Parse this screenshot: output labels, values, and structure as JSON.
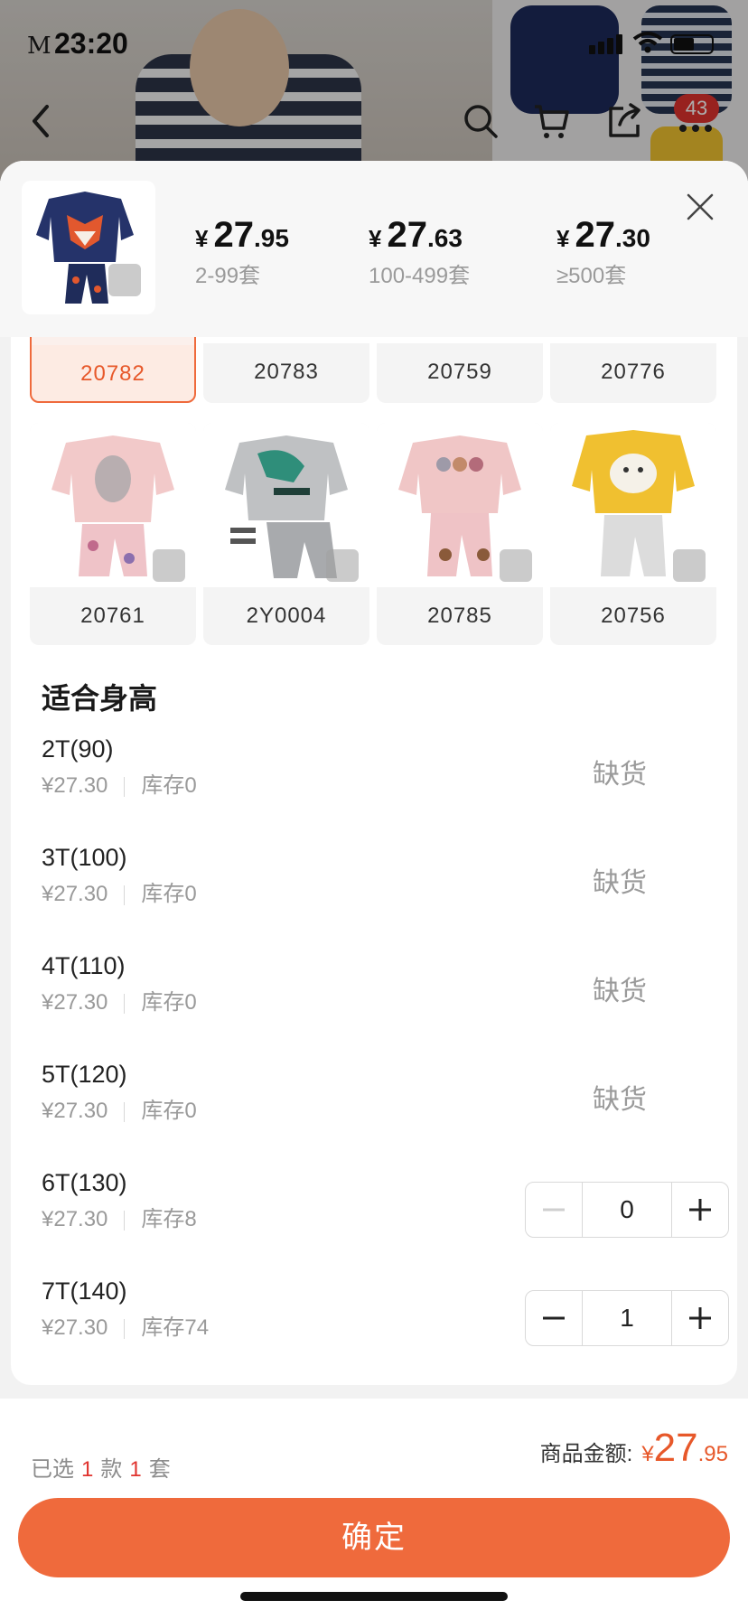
{
  "status_bar": {
    "brand": "M",
    "time": "23:20"
  },
  "nav": {
    "cart_badge": "43"
  },
  "price_tiers": [
    {
      "yen": "¥",
      "int": "27",
      "dec": ".95",
      "qty": "2-99套"
    },
    {
      "yen": "¥",
      "int": "27",
      "dec": ".63",
      "qty": "100-499套"
    },
    {
      "yen": "¥",
      "int": "27",
      "dec": ".30",
      "qty": "≥500套"
    }
  ],
  "swatches_row1": [
    {
      "code": "20782",
      "selected": true
    },
    {
      "code": "20783",
      "selected": false
    },
    {
      "code": "20759",
      "selected": false
    },
    {
      "code": "20776",
      "selected": false
    }
  ],
  "swatches_row2": [
    {
      "code": "20761"
    },
    {
      "code": "2Y0004"
    },
    {
      "code": "20785"
    },
    {
      "code": "20756"
    }
  ],
  "size_section_title": "适合身高",
  "sizes": [
    {
      "name": "2T(90)",
      "price": "¥27.30",
      "stock": "库存0",
      "status": "缺货"
    },
    {
      "name": "3T(100)",
      "price": "¥27.30",
      "stock": "库存0",
      "status": "缺货"
    },
    {
      "name": "4T(110)",
      "price": "¥27.30",
      "stock": "库存0",
      "status": "缺货"
    },
    {
      "name": "5T(120)",
      "price": "¥27.30",
      "stock": "库存0",
      "status": "缺货"
    },
    {
      "name": "6T(130)",
      "price": "¥27.30",
      "stock": "库存8",
      "qty": "0"
    },
    {
      "name": "7T(140)",
      "price": "¥27.30",
      "stock": "库存74",
      "qty": "1"
    }
  ],
  "footer": {
    "chosen_prefix": "已选",
    "chosen_styles": "1",
    "chosen_styles_unit": "款",
    "chosen_sets": "1",
    "chosen_sets_unit": "套",
    "total_label": "商品金额:",
    "total_yen": "¥",
    "total_int": "27",
    "total_dec": ".95",
    "confirm_label": "确定"
  },
  "colors": {
    "accent": "#ef6a3c",
    "accent_text": "#e7582a",
    "badge": "#e0332e"
  }
}
